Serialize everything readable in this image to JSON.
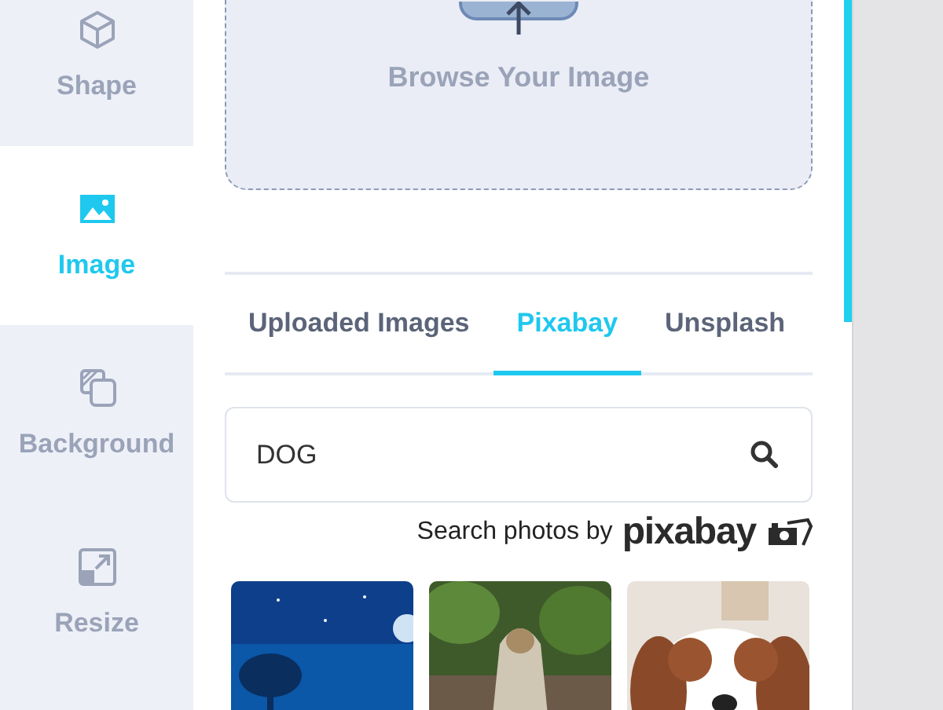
{
  "sidebar": {
    "items": [
      {
        "label": "Shape",
        "selected": false
      },
      {
        "label": "Image",
        "selected": true
      },
      {
        "label": "Background",
        "selected": false
      },
      {
        "label": "Resize",
        "selected": false
      }
    ]
  },
  "upload": {
    "label": "Browse Your Image"
  },
  "tabs": [
    {
      "label": "Uploaded Images",
      "selected": false
    },
    {
      "label": "Pixabay",
      "selected": true
    },
    {
      "label": "Unsplash",
      "selected": false
    }
  ],
  "search": {
    "value": "DOG"
  },
  "credit": {
    "text": "Search photos by",
    "brand": "pixabay"
  }
}
